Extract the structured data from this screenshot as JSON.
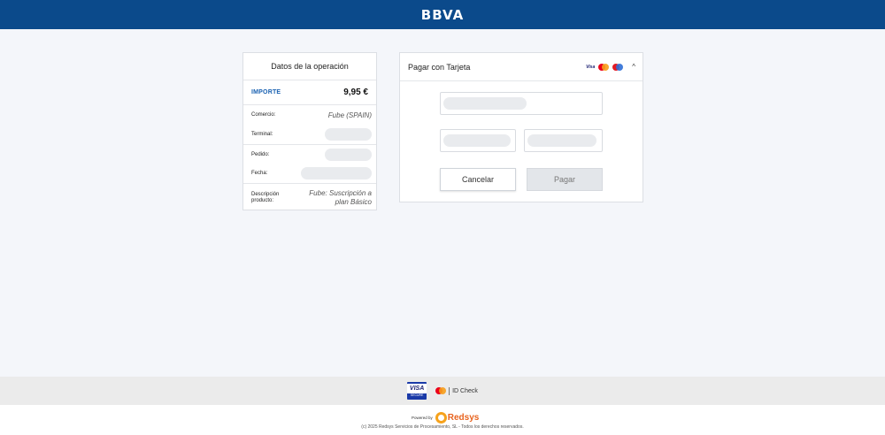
{
  "header": {
    "logo": "BBVA"
  },
  "operation": {
    "title": "Datos de la operación",
    "amount_label": "IMPORTE",
    "amount_value": "9,95 €",
    "rows": [
      {
        "label": "Comercio:",
        "value": "Fube (SPAIN)"
      },
      {
        "label": "Terminal:",
        "value": ""
      },
      {
        "label": "Pedido:",
        "value": ""
      },
      {
        "label": "Fecha:",
        "value": ""
      },
      {
        "label": "Descripción producto:",
        "value": "Fube: Suscripción a plan Básico"
      }
    ]
  },
  "payment": {
    "title": "Pagar con Tarjeta",
    "brands": [
      "Visa",
      "mastercard-icon",
      "maestro-icon"
    ],
    "visa_text": "Visa",
    "chevron": "^",
    "cancel_label": "Cancelar",
    "pay_label": "Pagar"
  },
  "footer": {
    "visa_badge": "VISA",
    "visa_badge_sub": "SECURE",
    "idcheck": "ID Check",
    "powered_by": "Powered by",
    "provider": "Redsys",
    "copyright": "(c) 2025 Redsys Servicios de Procesamiento, SL - Todos los derechos reservados."
  },
  "colors": {
    "header": "#0b4a8b",
    "accent": "#1a62b2"
  }
}
